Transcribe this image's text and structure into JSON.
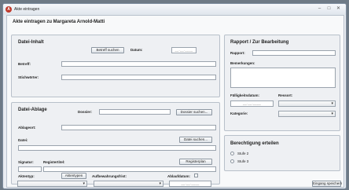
{
  "window": {
    "title": "Akte eintragen",
    "icon": "app-icon"
  },
  "heading": "Akte eintragen zu Margareta Arnold-Matti",
  "datei_inhalt": {
    "title": "Datei-Inhalt",
    "betreff_suchen": "Betreff suchen",
    "datum_label": "Datum:",
    "datum_value": "__.__.____",
    "betreff_label": "Betreff:",
    "stichwoerter_label": "Stichwörter:"
  },
  "datei_ablage": {
    "title": "Datei-Ablage",
    "dossier_label": "Dossier:",
    "dossier_suchen": "Dossier suchen...",
    "ablageort_label": "Ablageort:",
    "datei_label": "Datei:",
    "datei_suchen": "Datei suchen...",
    "signatur_label": "Signatur:",
    "registertitel_label": "Registertitel:",
    "registerplan": "Registerplan",
    "aktentyp_label": "Aktentyp:",
    "aktentypen_button": "Aktentypen",
    "aufbewahrungsfrist_label": "Aufbewahrungsfrist:",
    "ablaufdatum_label": "Ablaufdatum:",
    "ablaufdatum_value": "__.__.____"
  },
  "rapport": {
    "title": "Rapport / Zur Bearbeitung",
    "rapport_label": "Rapport:",
    "bemerkungen_label": "Bemerkungen:",
    "faelligkeitsdatum_label": "Fälligkeitsdatum:",
    "faelligkeitsdatum_value": "__.__.____",
    "ressort_label": "Ressort:",
    "kategorie_label": "Kategorie:"
  },
  "berechtigung": {
    "title": "Berechtigung erteilen",
    "options": [
      "Stufe 2",
      "Stufe 3"
    ]
  },
  "footer": {
    "eingang_speichern": "Eingang speichern"
  }
}
